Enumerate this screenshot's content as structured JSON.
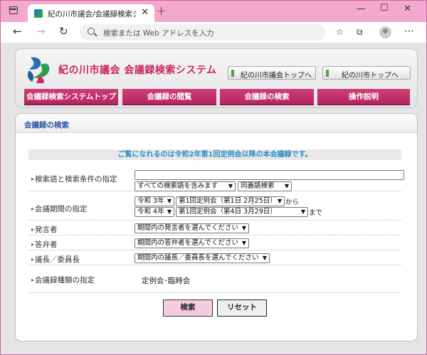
{
  "browser": {
    "tab_title": "紀の川市議会/会議録検索システム",
    "address_placeholder": "検索または Web アドレスを入力"
  },
  "header": {
    "site_title": "紀の川市議会 会議録検索システム",
    "links": [
      {
        "label": "紀の川市議会トップへ"
      },
      {
        "label": "紀の川市トップへ"
      }
    ],
    "menu": [
      {
        "label": "会議録検索システムトップ"
      },
      {
        "label": "会議録の閲覧"
      },
      {
        "label": "会議録の検索"
      },
      {
        "label": "操作説明"
      }
    ]
  },
  "panel": {
    "title": "会議録の検索",
    "notice": "ご覧になれるのは令和2年第1回定例会以降の本会議録です。"
  },
  "form": {
    "keyword": {
      "label": "検索語と検索条件の指定",
      "value": "",
      "condition": "すべての検索語を含みます",
      "synonym": "同義語検索"
    },
    "period": {
      "label": "会議期間の指定",
      "from_year": "令和 3年",
      "from_session": "第1回定例会（第1日 2月25日）",
      "from_suffix": "から",
      "to_year": "令和 4年",
      "to_session": "第1回定例会（第4日 3月29日）",
      "to_suffix": "まで"
    },
    "speaker": {
      "label": "発言者",
      "value": "期間内の発言者を選んでください"
    },
    "answerer": {
      "label": "答弁者",
      "value": "期間内の答弁者を選んでください"
    },
    "chair": {
      "label": "議長／委員長",
      "value": "期間内の議長／委員長を選んでください"
    },
    "type": {
      "label": "会議録種類の指定",
      "value": "定例会･臨時会"
    }
  },
  "buttons": {
    "search": "検索",
    "reset": "リセット"
  },
  "colors": {
    "accent": "#c9285f",
    "link_blue": "#2a56a5",
    "notice_blue": "#2d8fc4",
    "window_pink": "#f3a8cd"
  }
}
